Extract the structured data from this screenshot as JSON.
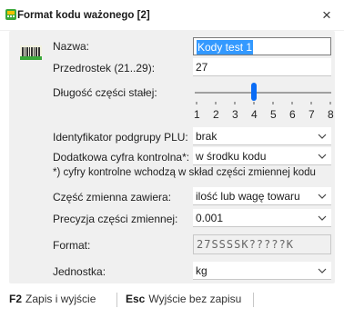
{
  "window": {
    "title": "Format kodu ważonego [2]",
    "icon": "cash-register-icon",
    "close_label": "×"
  },
  "form": {
    "name_label": "Nazwa:",
    "name_value": "Kody test 1",
    "prefix_label": "Przedrostek (21..29):",
    "prefix_value": "27",
    "fixed_length_label": "Długość części stałej:",
    "fixed_length_value": 4,
    "fixed_length_ticks": [
      "1",
      "2",
      "3",
      "4",
      "5",
      "6",
      "7",
      "8"
    ],
    "plu_label": "Identyfikator podgrupy PLU:",
    "plu_value": "brak",
    "check_digit_label": "Dodatkowa cyfra kontrolna*:",
    "check_digit_value": "w środku kodu",
    "note": "*) cyfry kontrolne wchodzą w skład części zmiennej kodu",
    "variable_label": "Część zmienna zawiera:",
    "variable_value": "ilość lub wagę towaru",
    "precision_label": "Precyzja części zmiennej:",
    "precision_value": "0.001",
    "format_label": "Format:",
    "format_value": "27SSSSK?????K",
    "unit_label": "Jednostka:",
    "unit_value": "kg"
  },
  "footer": {
    "save_key": "F2",
    "save_label": "Zapis i wyjście",
    "cancel_key": "Esc",
    "cancel_label": "Wyjście bez zapisu"
  },
  "colors": {
    "selection": "#3399ff",
    "slider_thumb": "#0a6cf5",
    "icon_green": "#3aa83a",
    "icon_yellow": "#f2c200"
  }
}
